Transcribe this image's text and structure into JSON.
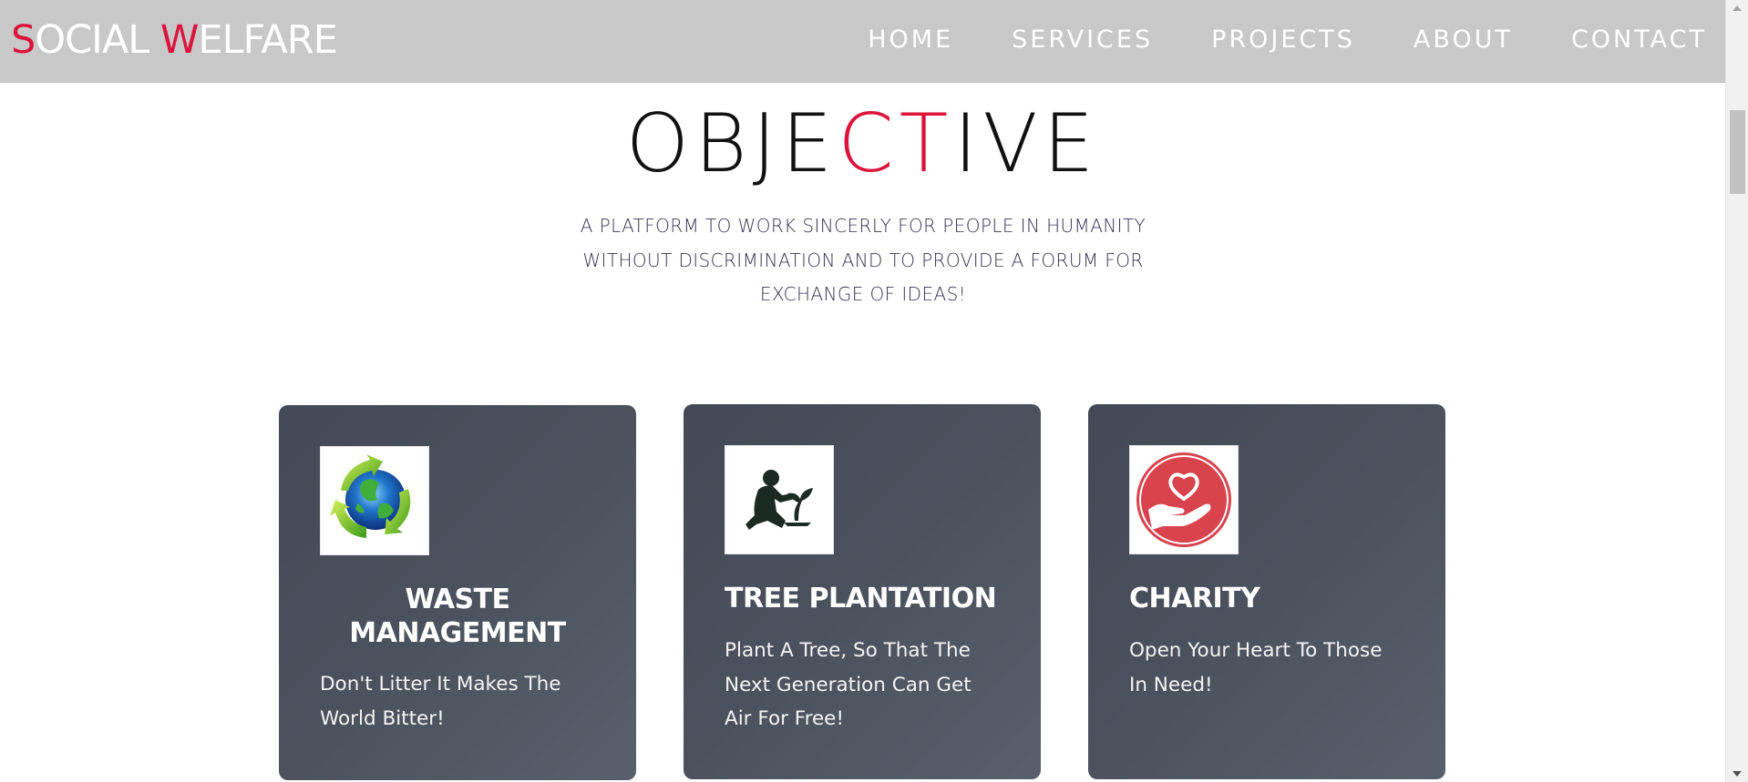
{
  "brand": {
    "letters": [
      {
        "text": "S",
        "accent": true
      },
      {
        "text": "OCIAL ",
        "accent": false
      },
      {
        "text": "W",
        "accent": true
      },
      {
        "text": "ELFARE",
        "accent": false
      }
    ]
  },
  "nav": {
    "items": [
      "HOME",
      "SERVICES",
      "PROJECTS",
      "ABOUT",
      "CONTACT"
    ]
  },
  "objective": {
    "title_parts": [
      {
        "text": "OBJE",
        "accent": false
      },
      {
        "text": "CT",
        "accent": true
      },
      {
        "text": "IVE",
        "accent": false
      }
    ],
    "text": "A PLATFORM TO WORK SINCERLY FOR PEOPLE IN HUMANITY WITHOUT DISCRIMINATION AND TO PROVIDE A FORUM FOR EXCHANGE OF IDEAS!"
  },
  "cards": [
    {
      "icon": "recycle-globe-icon",
      "title": "WASTE MANAGEMENT",
      "text": "Don't Litter It Makes The World Bitter!"
    },
    {
      "icon": "tree-planting-icon",
      "title": "TREE PLANTATION",
      "text": "Plant A Tree, So That The Next Generation Can Get Air For Free!"
    },
    {
      "icon": "heart-in-hand-icon",
      "title": "CHARITY",
      "text": "Open Your Heart To Those In Need!"
    }
  ],
  "colors": {
    "accent": "#dc143c",
    "navbar_bg": "#c8c8c8",
    "card_bg": "#4b525e"
  }
}
